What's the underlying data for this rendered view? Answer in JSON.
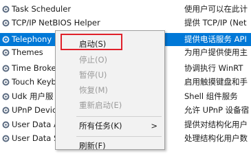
{
  "services": [
    {
      "name": "Task Scheduler",
      "desc": "使用户可以在此计",
      "selected": false
    },
    {
      "name": "TCP/IP NetBIOS Helper",
      "desc": "提供 TCP/IP (Net",
      "selected": false
    },
    {
      "name": "Telephony",
      "desc": "提供电话服务 API",
      "selected": true
    },
    {
      "name": "Themes",
      "desc": "为用户提供使用主",
      "selected": false
    },
    {
      "name": "Time Broke",
      "desc": "协调执行 WinRT",
      "selected": false
    },
    {
      "name": "Touch Keyb",
      "desc": "启用触摸键盘和手",
      "selected": false
    },
    {
      "name": "Udk 用户服",
      "desc": "Shell 组件服务",
      "selected": false
    },
    {
      "name": "UPnP Devic",
      "desc": "允许 UPnP 设备宿",
      "selected": false
    },
    {
      "name": "User Data A",
      "desc": "提供对结构化用户",
      "selected": false
    },
    {
      "name": "User Data S",
      "desc": "处理结构化用户数",
      "selected": false
    }
  ],
  "context_menu": {
    "start": "启动(S)",
    "stop": "停止(O)",
    "pause": "暂停(U)",
    "resume": "恢复(M)",
    "restart": "重新启动(E)",
    "all_tasks": "所有任务(K)",
    "all_tasks_arrow": ">",
    "refresh": "刷新(F)"
  },
  "colors": {
    "selection": "#0078d7",
    "highlight_box": "#e0202a"
  }
}
